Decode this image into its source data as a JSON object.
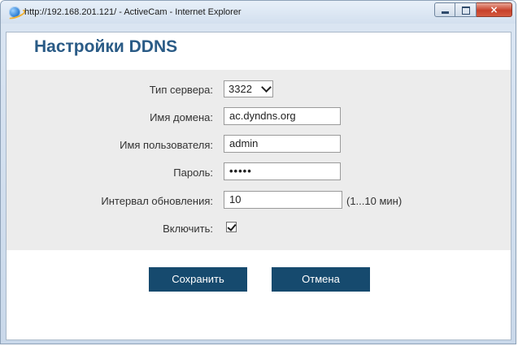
{
  "window": {
    "title": "http://192.168.201.121/ - ActiveCam - Internet Explorer",
    "caption_buttons": {
      "minimize": "minimize-icon",
      "maximize": "maximize-icon",
      "close": "×"
    }
  },
  "page": {
    "heading": "Настройки DDNS"
  },
  "form": {
    "server_type": {
      "label": "Тип сервера:",
      "value": "3322"
    },
    "domain": {
      "label": "Имя домена:",
      "value": "ac.dyndns.org"
    },
    "username": {
      "label": "Имя пользователя:",
      "value": "admin"
    },
    "password": {
      "label": "Пароль:",
      "value": "•••••"
    },
    "update_interval": {
      "label": "Интервал обновления:",
      "value": "10",
      "suffix": "(1...10 мин)"
    },
    "enable": {
      "label": "Включить:",
      "checked": true
    }
  },
  "buttons": {
    "save": "Сохранить",
    "cancel": "Отмена"
  },
  "colors": {
    "heading": "#2a5b86",
    "button_bg": "#164a6e",
    "panel_bg": "#ececec"
  }
}
